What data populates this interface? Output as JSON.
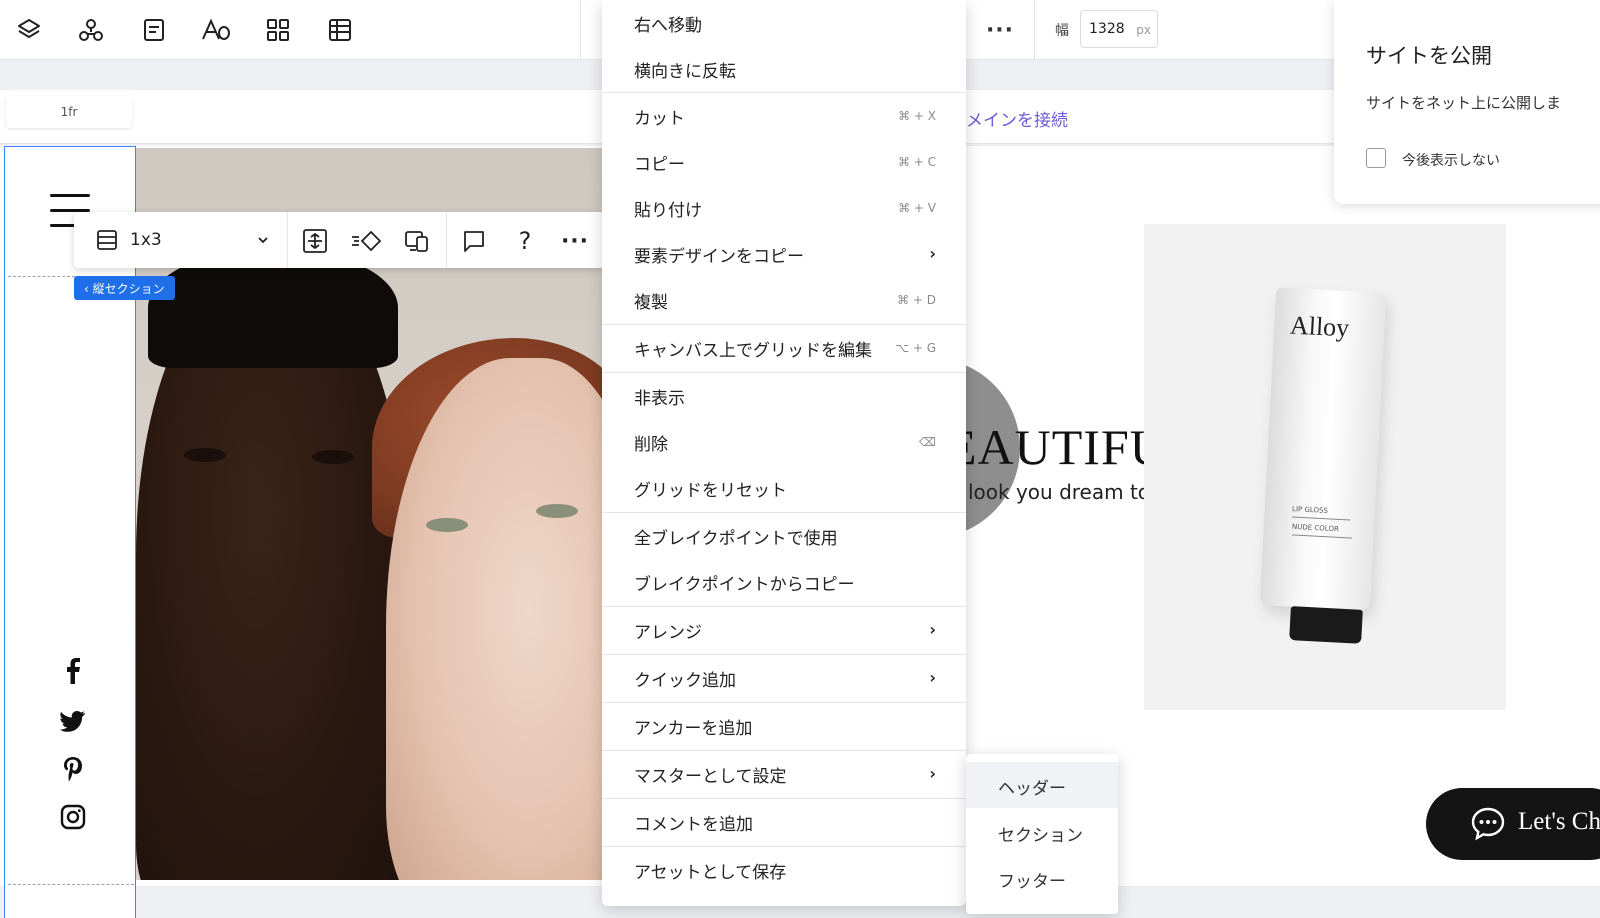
{
  "toolbar": {
    "icons": [
      "layers-icon",
      "components-icon",
      "pages-icon",
      "text-theme-icon",
      "apps-icon",
      "table-icon"
    ],
    "width_label": "幅",
    "width_value": "1328",
    "width_unit": "px"
  },
  "canvas": {
    "fr_chip": "1fr",
    "domain_link": "メインを接続"
  },
  "element_toolbar": {
    "grid_select_label": "1x3",
    "help_glyph": "?",
    "more_glyph": "···",
    "section_tag": "‹ 縦セクション"
  },
  "site": {
    "headline": "EAUTIFUL",
    "subline": "look you dream to have.",
    "product_brand": "Alloy",
    "product_lines": [
      "LIP GLOSS",
      "NUDE COLOR"
    ],
    "chat_label": "Let's Ch",
    "social_icons": [
      "facebook-icon",
      "twitter-icon",
      "pinterest-icon",
      "instagram-icon"
    ]
  },
  "publish_popup": {
    "title": "サイトを公開",
    "description": "サイトをネット上に公開しま",
    "checkbox_label": "今後表示しない"
  },
  "context_menu": {
    "items": [
      {
        "label": "右へ移動",
        "shortcut": ""
      },
      {
        "label": "横向きに反転",
        "shortcut": ""
      },
      {
        "label": "カット",
        "shortcut": "⌘ + X"
      },
      {
        "label": "コピー",
        "shortcut": "⌘ + C"
      },
      {
        "label": "貼り付け",
        "shortcut": "⌘ + V"
      },
      {
        "label": "要素デザインをコピー",
        "shortcut": "›"
      },
      {
        "label": "複製",
        "shortcut": "⌘ + D"
      },
      {
        "label": "キャンバス上でグリッドを編集",
        "shortcut": "⌥ + G"
      },
      {
        "label": "非表示",
        "shortcut": ""
      },
      {
        "label": "削除",
        "shortcut": "⌫"
      },
      {
        "label": "グリッドをリセット",
        "shortcut": ""
      },
      {
        "label": "全ブレイクポイントで使用",
        "shortcut": ""
      },
      {
        "label": "ブレイクポイントからコピー",
        "shortcut": ""
      },
      {
        "label": "アレンジ",
        "shortcut": "›"
      },
      {
        "label": "クイック追加",
        "shortcut": "›"
      },
      {
        "label": "アンカーを追加",
        "shortcut": ""
      },
      {
        "label": "マスターとして設定",
        "shortcut": "›"
      },
      {
        "label": "コメントを追加",
        "shortcut": ""
      },
      {
        "label": "アセットとして保存",
        "shortcut": ""
      }
    ]
  },
  "submenu": {
    "items": [
      {
        "label": "ヘッダー"
      },
      {
        "label": "セクション"
      },
      {
        "label": "フッター"
      }
    ]
  },
  "colors": {
    "selection_blue": "#3a86ff",
    "section_tag_bg": "#1f6feb",
    "link_purple": "#6b5bd6",
    "chat_bg": "#141414"
  }
}
